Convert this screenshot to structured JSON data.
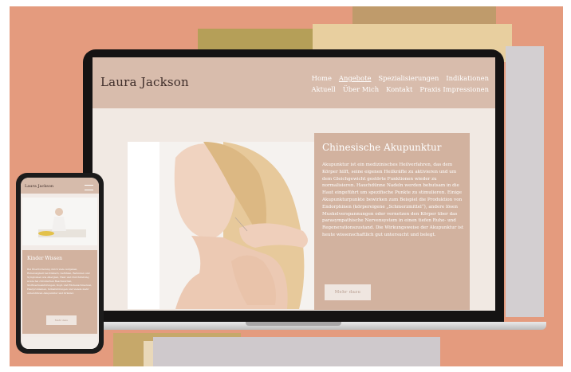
{
  "site": {
    "logo": "Laura Jackson",
    "nav_row1": [
      "Home",
      "Angebote",
      "Spezialisierungen",
      "Indikationen"
    ],
    "nav_row2": [
      "Aktuell",
      "Über Mich",
      "Kontakt",
      "Praxis Impressionen"
    ],
    "active_nav": "Angebote"
  },
  "card": {
    "title": "Chinesische Akupunktur",
    "body": "Akupunktur ist ein medizinisches Heilverfahren, das dem Körper hilft, seine eigenen Heilkräfte zu aktivieren und um dem Gleichgewicht gestörte Funktionen wieder zu normalisieren. Hauchdünne Nadeln werden behutsam in die Haut eingeführt um spezifische Punkte zu stimulieren. Einige Akupunkturpunkte bewirken zum Beispiel die Produktion von Endorphinen (körpereigene „Schmerzmittel“), andere lösen Muskelverspannungen oder vernetzen den Körper über das parasympathische Nervensystem in einen tiefen Ruhe- und Regenerationszustand. Die Wirkungsweise der Akupunktur ist heute wissenschaftlich gut untersucht und belegt.",
    "button": "Mehr dazu"
  },
  "mobile": {
    "logo": "Laura Jackson",
    "card_title": "Kinder Wissen",
    "card_body": "Bei Überforderung durch viele Aufgaben, Ruhelosigkeit bei Kindern, Gefühlen, Befunden und Symptomen wie Allergien, Haut und Durchblutung sowie bei chronischen Beschwerden, Stoffwechselstörungen, Kopf- und Rückenschmerzen, Hautproblemen, Schlafstörungen und vielem mehr unterstützen Akupunktur und Kräuter.",
    "button": "Mehr dazu"
  },
  "colors": {
    "background": "#e49b7e",
    "header": "#d8bcac",
    "card": "#d2b29f",
    "page": "#f1e9e3"
  }
}
